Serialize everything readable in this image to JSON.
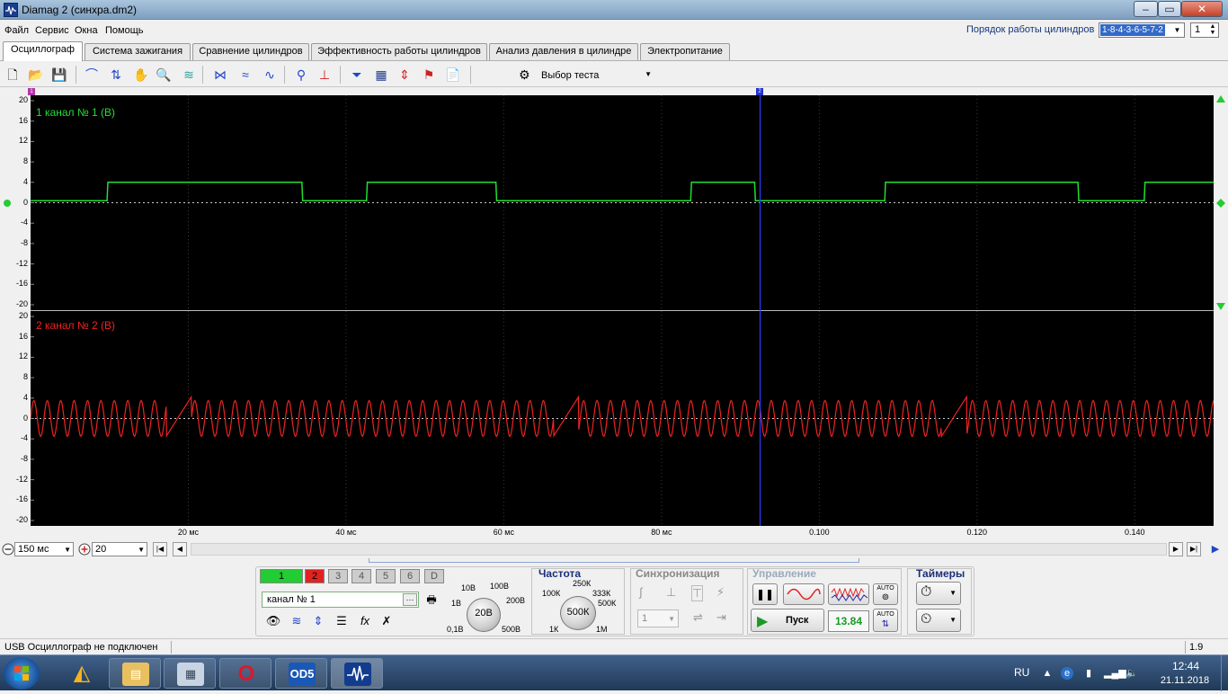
{
  "window": {
    "title": "Diamag 2 (синхра.dm2)",
    "min": "–",
    "max": "▭",
    "close": "✕"
  },
  "menu": [
    "Файл",
    "Сервис",
    "Окна",
    "Помощь"
  ],
  "cylinder_order": {
    "label": "Порядок работы цилиндров",
    "value": "1-8-4-3-6-5-7-2",
    "spin_value": "1"
  },
  "tabs": [
    "Осциллограф",
    "Система зажигания",
    "Сравнение цилиндров",
    "Эффективность работы цилиндров",
    "Анализ давления в цилиндре",
    "Электропитание"
  ],
  "toolbar": {
    "test_select_label": "Выбор теста"
  },
  "chart_data": {
    "type": "line",
    "channels": [
      {
        "label": "1  канал № 1 (В)",
        "color": "#22dd33",
        "y_ticks": [
          "20",
          "16",
          "12",
          "8",
          "4",
          "0",
          "-4",
          "-8",
          "-12",
          "-16",
          "-20"
        ],
        "ylim": [
          -20,
          20
        ]
      },
      {
        "label": "2  канал № 2 (В)",
        "color": "#ee2222",
        "y_ticks": [
          "20",
          "16",
          "12",
          "8",
          "4",
          "0",
          "-4",
          "-8",
          "-12",
          "-16",
          "-20"
        ],
        "ylim": [
          -20,
          20
        ]
      }
    ],
    "x_ticks": [
      "20 мс",
      "40 мс",
      "60 мс",
      "80 мс",
      "0.100",
      "0.120",
      "0.140"
    ],
    "xlim": [
      0,
      0.15
    ],
    "cursor_x": 0.0925,
    "series": [
      {
        "channel": 1,
        "x": [
          0,
          0.0097,
          0.0098,
          0.0344,
          0.0345,
          0.0426,
          0.0427,
          0.059,
          0.0591,
          0.0837,
          0.0838,
          0.0918,
          0.0919,
          0.1083,
          0.1084,
          0.1328,
          0.1329,
          0.1412,
          0.1413,
          0.15
        ],
        "values": [
          0.4,
          0.4,
          4,
          4,
          0.4,
          0.4,
          4,
          4,
          0.4,
          0.4,
          4,
          4,
          0.4,
          0.4,
          4,
          4,
          0.4,
          0.4,
          4,
          4
        ]
      },
      {
        "channel": 2,
        "waveform": "sine",
        "amplitude": 3.5,
        "period": 0.0017,
        "gaps_start": [
          0.0172,
          0.0663,
          0.1155
        ],
        "gap_length": 0.0032
      }
    ]
  },
  "nav": {
    "timebase": "150  мс",
    "scale": "20"
  },
  "control": {
    "channels": [
      "1",
      "2",
      "3",
      "4",
      "5",
      "6",
      "D"
    ],
    "channel_name": "канал № 1",
    "voltage_dial": {
      "value": "20В",
      "labels": [
        "10В",
        "100В",
        "1В",
        "200В",
        "0,1В",
        "500В"
      ]
    },
    "freq": {
      "title": "Частота",
      "value": "500К",
      "labels": [
        "250К",
        "100К",
        "333К",
        "500К",
        "1К",
        "1М"
      ]
    },
    "sync": {
      "title": "Синхронизация",
      "channel": "1"
    },
    "manage": {
      "title": "Управление",
      "start": "Пуск",
      "value": "13.84",
      "auto": "AUTO"
    },
    "timers": {
      "title": "Таймеры"
    }
  },
  "status": {
    "text": "USB Осциллограф не подключен",
    "version": "1.9"
  },
  "taskbar": {
    "lang": "RU",
    "time": "12:44",
    "date": "21.11.2018",
    "od5": "OD5"
  }
}
